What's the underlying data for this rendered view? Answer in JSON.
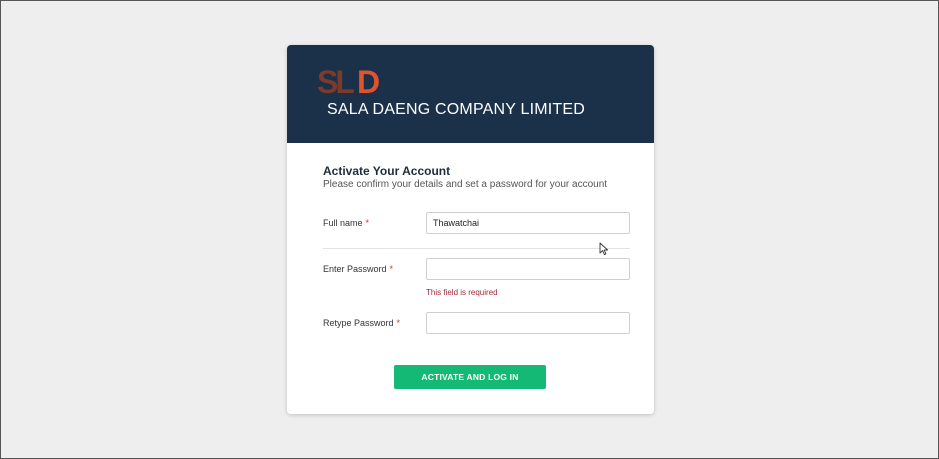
{
  "header": {
    "logo_text": "SLD",
    "company_name": "SALA DAENG COMPANY LIMITED",
    "bg_color": "#1b3049"
  },
  "form": {
    "title": "Activate Your Account",
    "subtitle": "Please confirm your details and set a password for your account",
    "required_marker": "*",
    "fields": [
      {
        "label": "Full name",
        "value": "Thawatchai",
        "type": "text"
      },
      {
        "label": "Enter Password",
        "value": "",
        "type": "password",
        "error": "This field is required"
      },
      {
        "label": "Retype Password",
        "value": "",
        "type": "password"
      }
    ],
    "submit_label": "ACTIVATE AND LOG IN",
    "submit_color": "#14b975",
    "error_color": "#a0283c"
  },
  "icons": {
    "logo": "sld-logo-icon",
    "cursor": "mouse-cursor-icon"
  }
}
